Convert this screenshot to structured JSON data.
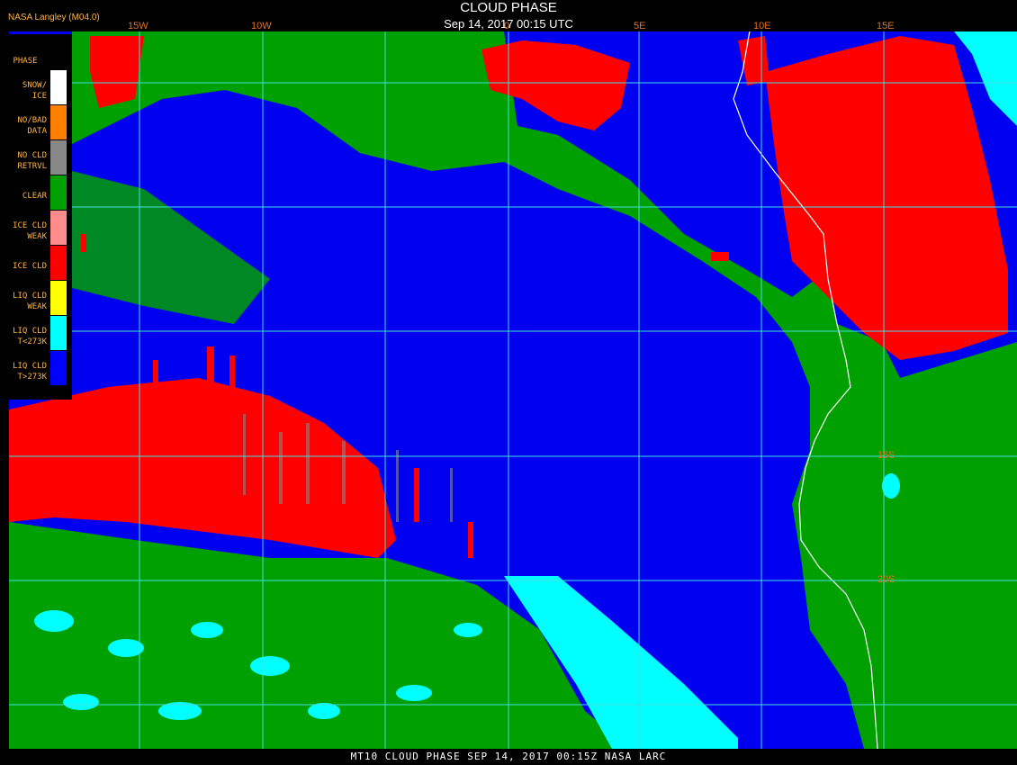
{
  "header": {
    "title": "CLOUD PHASE",
    "datetime": "Sep 14, 2017 00:15 UTC",
    "producer": "NASA Langley (M04.0)"
  },
  "map": {
    "lon_labels": [
      "15W",
      "10W",
      "0",
      "5E",
      "10E",
      "15E"
    ],
    "lat_labels": [
      "15S",
      "20S"
    ]
  },
  "legend": {
    "title": "PHASE",
    "items": [
      {
        "label": "SNOW/\nICE",
        "color": "#ffffff"
      },
      {
        "label": "NO/BAD\nDATA",
        "color": "#ff8000"
      },
      {
        "label": "NO CLD\nRETRVL",
        "color": "#888888"
      },
      {
        "label": "CLEAR",
        "color": "#00a000"
      },
      {
        "label": "ICE CLD\nWEAK",
        "color": "#ff8c8c"
      },
      {
        "label": "ICE CLD",
        "color": "#ff0000"
      },
      {
        "label": "LIQ CLD\nWEAK",
        "color": "#ffff00"
      },
      {
        "label": "LIQ CLD\nT<273K",
        "color": "#00ffff"
      },
      {
        "label": "LIQ CLD\nT>273K",
        "color": "#0000ff"
      }
    ]
  },
  "footer": {
    "caption": "MT10  CLOUD PHASE  SEP 14, 2017 00:15Z  NASA LARC"
  },
  "colors": {
    "liquid_warm": "#0000ff",
    "liquid_cold": "#00ffff",
    "ice": "#ff0000",
    "clear": "#00a000",
    "grid": "#40e0e0",
    "coastline": "#ffffff"
  }
}
